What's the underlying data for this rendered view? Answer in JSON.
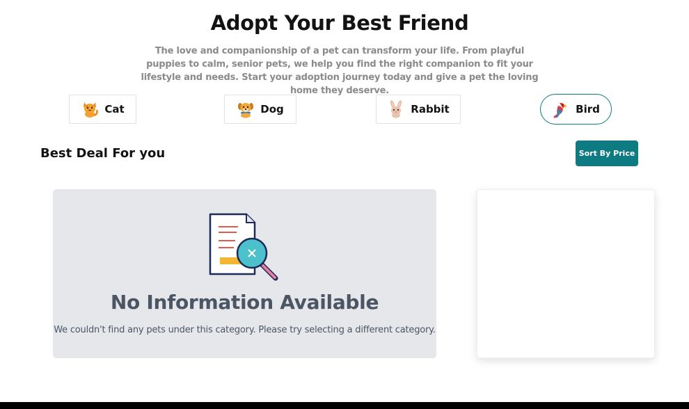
{
  "header": {
    "title": "Adopt Your Best Friend",
    "subtitle": "The love and companionship of a pet can transform your life. From playful puppies to calm, senior pets, we help you find the right companion to fit your lifestyle and needs. Start your adoption journey today and give a pet the loving home they deserve."
  },
  "categories": [
    {
      "label": "Cat",
      "icon": "cat-icon",
      "active": false
    },
    {
      "label": "Dog",
      "icon": "dog-icon",
      "active": false
    },
    {
      "label": "Rabbit",
      "icon": "rabbit-icon",
      "active": false
    },
    {
      "label": "Bird",
      "icon": "bird-icon",
      "active": true
    }
  ],
  "deals": {
    "title": "Best Deal For you",
    "sort_label": "Sort By Price"
  },
  "empty_state": {
    "icon": "document-search-not-found-icon",
    "title": "No Information Available",
    "description": "We couldn't find any pets under this category. Please try selecting a different category."
  },
  "colors": {
    "accent": "#0e7a81",
    "panel_bg": "#e5e7eb",
    "text_muted": "#4b5563"
  }
}
